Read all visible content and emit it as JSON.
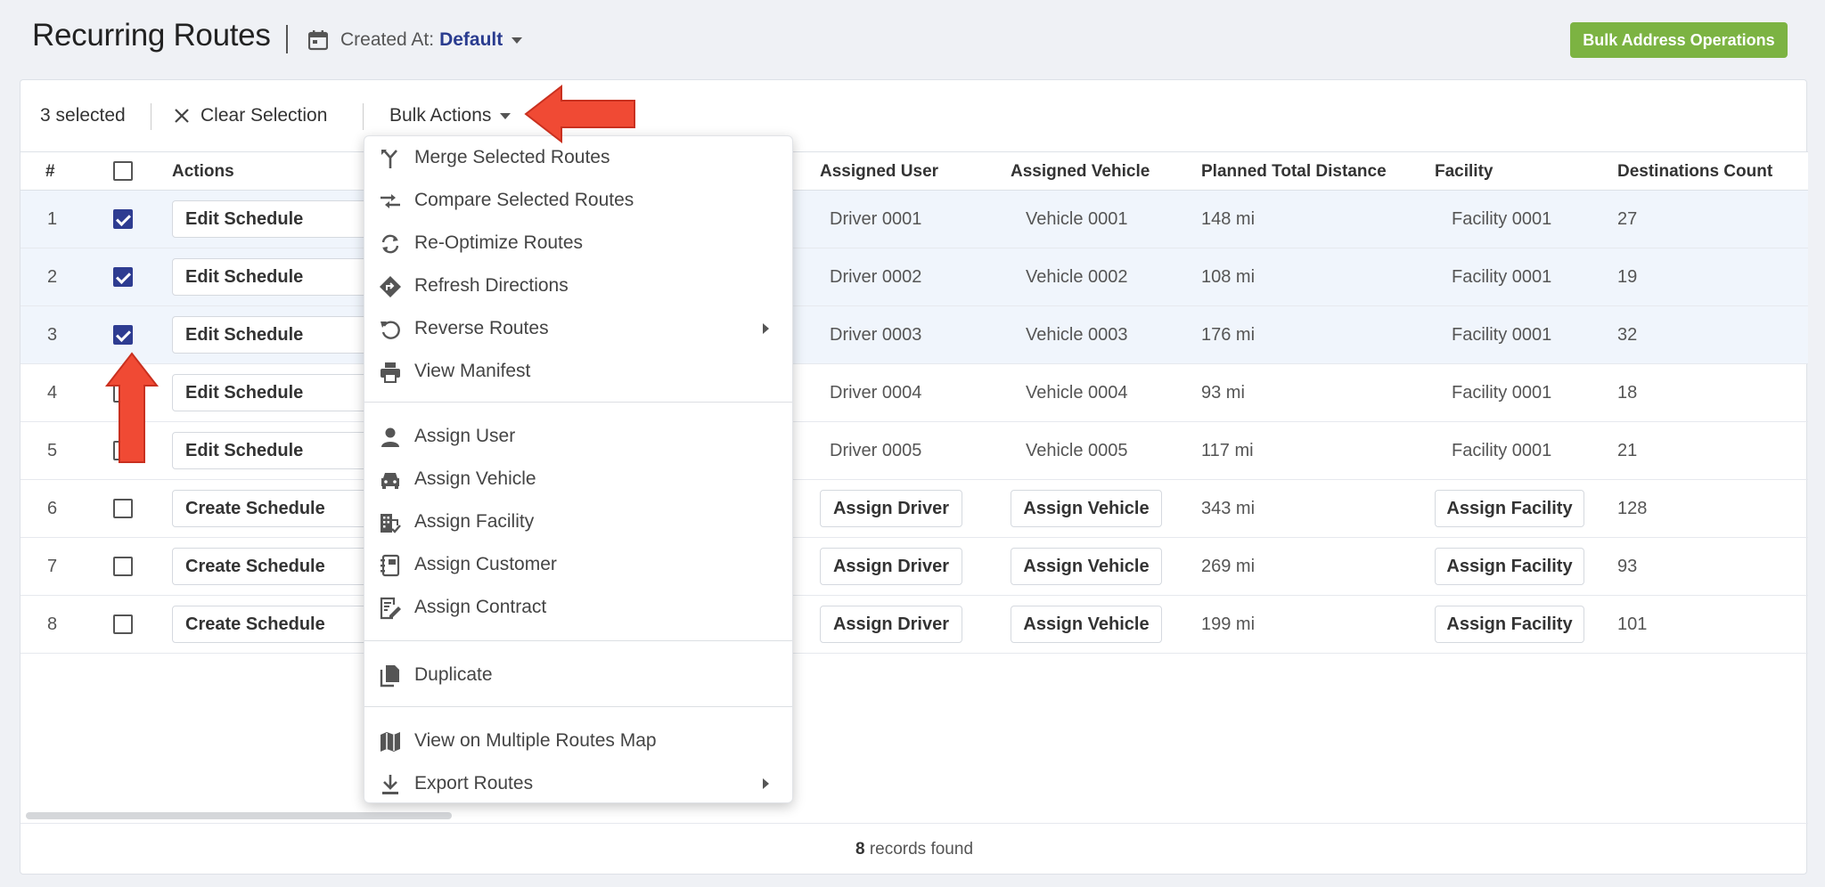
{
  "header": {
    "title": "Recurring Routes",
    "created_at_label": "Created At:",
    "created_at_value": "Default",
    "bulk_address_button": "Bulk Address Operations"
  },
  "toolbar": {
    "selected_count": "3 selected",
    "clear_selection": "Clear Selection",
    "bulk_actions": "Bulk Actions"
  },
  "table": {
    "columns": [
      "#",
      "Actions",
      "Assigned User",
      "Assigned Vehicle",
      "Planned Total Distance",
      "Facility",
      "Destinations Count"
    ],
    "rows": [
      {
        "num": "1",
        "checked": true,
        "action": "Edit Schedule",
        "user": "Driver 0001",
        "vehicle": "Vehicle 0001",
        "distance": "148 mi",
        "facility": "Facility 0001",
        "count": "27"
      },
      {
        "num": "2",
        "checked": true,
        "action": "Edit Schedule",
        "user": "Driver 0002",
        "vehicle": "Vehicle 0002",
        "distance": "108 mi",
        "facility": "Facility 0001",
        "count": "19"
      },
      {
        "num": "3",
        "checked": true,
        "action": "Edit Schedule",
        "user": "Driver 0003",
        "vehicle": "Vehicle 0003",
        "distance": "176 mi",
        "facility": "Facility 0001",
        "count": "32"
      },
      {
        "num": "4",
        "checked": false,
        "action": "Edit Schedule",
        "user": "Driver 0004",
        "vehicle": "Vehicle 0004",
        "distance": "93 mi",
        "facility": "Facility 0001",
        "count": "18"
      },
      {
        "num": "5",
        "checked": false,
        "action": "Edit Schedule",
        "user": "Driver 0005",
        "vehicle": "Vehicle 0005",
        "distance": "117 mi",
        "facility": "Facility 0001",
        "count": "21"
      },
      {
        "num": "6",
        "checked": false,
        "action": "Create Schedule",
        "user": "Assign Driver",
        "vehicle": "Assign Vehicle",
        "distance": "343 mi",
        "facility": "Assign Facility",
        "count": "128"
      },
      {
        "num": "7",
        "checked": false,
        "action": "Create Schedule",
        "user": "Assign Driver",
        "vehicle": "Assign Vehicle",
        "distance": "269 mi",
        "facility": "Assign Facility",
        "count": "93"
      },
      {
        "num": "8",
        "checked": false,
        "action": "Create Schedule",
        "user": "Assign Driver",
        "vehicle": "Assign Vehicle",
        "distance": "199 mi",
        "facility": "Assign Facility",
        "count": "101"
      }
    ]
  },
  "menu": {
    "items": [
      {
        "label": "Merge Selected Routes",
        "icon": "merge-icon"
      },
      {
        "label": "Compare Selected Routes",
        "icon": "compare-icon"
      },
      {
        "label": "Re-Optimize Routes",
        "icon": "sync-icon"
      },
      {
        "label": "Refresh Directions",
        "icon": "directions-icon"
      },
      {
        "label": "Reverse Routes",
        "icon": "reverse-icon"
      },
      {
        "label": "View Manifest",
        "icon": "print-icon"
      },
      {
        "label": "Assign User",
        "icon": "person-icon"
      },
      {
        "label": "Assign Vehicle",
        "icon": "car-icon"
      },
      {
        "label": "Assign Facility",
        "icon": "building-icon"
      },
      {
        "label": "Assign Customer",
        "icon": "contact-book-icon"
      },
      {
        "label": "Assign Contract",
        "icon": "contract-icon"
      },
      {
        "label": "Duplicate",
        "icon": "copy-icon"
      },
      {
        "label": "View on Multiple Routes Map",
        "icon": "map-icon"
      },
      {
        "label": "Export Routes",
        "icon": "download-icon"
      }
    ]
  },
  "footer": {
    "count": "8",
    "text": "records found"
  },
  "colors": {
    "accent": "#2e3c91",
    "green": "#7cb342",
    "annotation": "#f04a34"
  }
}
